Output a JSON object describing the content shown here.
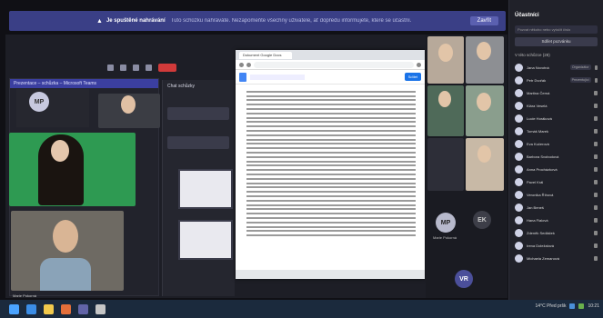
{
  "notice": {
    "warning_icon": "warning-icon",
    "title": "Je spuštěné nahrávání",
    "body": "Tuto schůzku nahráváte. Nezapomeňte všechny uživatele, ať dopředu informujete, které se účastní.",
    "dismiss": "Zavřít"
  },
  "inner_window": {
    "title": "Prezentace – schůzka – Microsoft Teams"
  },
  "tiles": {
    "mp_initials": "MP"
  },
  "chat": {
    "header": "Chat schůzky"
  },
  "browser": {
    "tab_title": "Dokument Google Docs",
    "share_label": "Sdílet"
  },
  "gallery": {
    "mp_initials": "MP",
    "vr_initials": "VR",
    "ek_initials": "EK",
    "mp_name": "Marie Pokorná"
  },
  "sidebar": {
    "title": "Účastníci",
    "search_placeholder": "Pozvat někoho nebo vytočit číslo",
    "share_invite": "Sdílet pozvánku",
    "section_in_meeting": "V této schůzce (28)",
    "section_other": "Ostatní",
    "participants": [
      {
        "name": "Jana Novotná",
        "tag": "Organizátor"
      },
      {
        "name": "Petr Dvořák",
        "tag": "Prezentující"
      },
      {
        "name": "Martina Černá",
        "tag": ""
      },
      {
        "name": "Klára Veselá",
        "tag": ""
      },
      {
        "name": "Lucie Horáková",
        "tag": ""
      },
      {
        "name": "Tomáš Marek",
        "tag": ""
      },
      {
        "name": "Eva Kučerová",
        "tag": ""
      },
      {
        "name": "Barbora Svobodová",
        "tag": ""
      },
      {
        "name": "Anna Procházková",
        "tag": ""
      },
      {
        "name": "Pavel Král",
        "tag": ""
      },
      {
        "name": "Veronika Říhová",
        "tag": ""
      },
      {
        "name": "Jan Beneš",
        "tag": ""
      },
      {
        "name": "Hana Fialová",
        "tag": ""
      },
      {
        "name": "Zdeněk Sedláček",
        "tag": ""
      },
      {
        "name": "Irena Doležalová",
        "tag": ""
      },
      {
        "name": "Michaela Zemanová",
        "tag": ""
      }
    ]
  },
  "bottom_label": "Marie Pokorná",
  "taskbar": {
    "tray_text": "14°C  Před pršk",
    "clock": "10:21",
    "date": "20.10.2021"
  }
}
